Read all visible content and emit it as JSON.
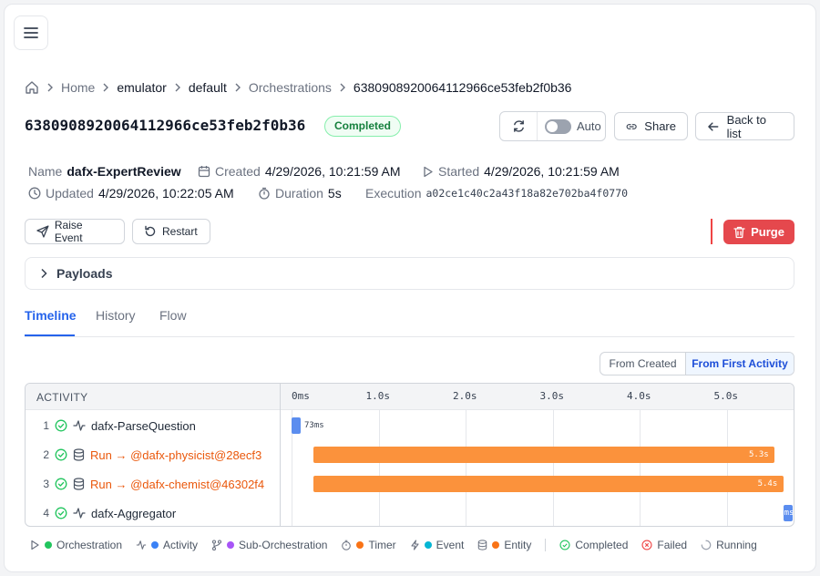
{
  "breadcrumb": {
    "items": [
      "Home",
      "emulator",
      "default",
      "Orchestrations",
      "6380908920064112966ce53feb2f0b36"
    ]
  },
  "title": "6380908920064112966ce53feb2f0b36",
  "status": "Completed",
  "toolbar": {
    "auto_label": "Auto",
    "share_label": "Share",
    "back_label": "Back to list"
  },
  "meta": {
    "name_label": "Name",
    "name_value": "dafx-ExpertReview",
    "created_label": "Created",
    "created_value": "4/29/2026, 10:21:59 AM",
    "started_label": "Started",
    "started_value": "4/29/2026, 10:21:59 AM",
    "updated_label": "Updated",
    "updated_value": "4/29/2026, 10:22:05 AM",
    "duration_label": "Duration",
    "duration_value": "5s",
    "execution_label": "Execution",
    "execution_value": "a02ce1c40c2a43f18a82e702ba4f0770"
  },
  "actions": {
    "raise_event": "Raise Event",
    "restart": "Restart",
    "purge": "Purge"
  },
  "payloads_label": "Payloads",
  "tabs": [
    "Timeline",
    "History",
    "Flow"
  ],
  "view_mode": {
    "options": [
      "From Created",
      "From First Activity"
    ],
    "selected": "From First Activity"
  },
  "timeline": {
    "header": "ACTIVITY",
    "ticks": [
      "0ms",
      "1.0s",
      "2.0s",
      "3.0s",
      "4.0s",
      "5.0s"
    ],
    "rows": [
      {
        "num": "1",
        "type": "activity",
        "label": "dafx-ParseQuestion",
        "start_s": 0.0,
        "duration_s": 0.073,
        "bar_label": "73ms",
        "color": "#5b8def"
      },
      {
        "num": "2",
        "type": "entity",
        "label": "Run → @dafx-physicist@28ecf3",
        "start_s": 0.25,
        "duration_s": 5.3,
        "bar_label": "5.3s",
        "color": "#fb923c"
      },
      {
        "num": "3",
        "type": "entity",
        "label": "Run → @dafx-chemist@46302f4",
        "start_s": 0.25,
        "duration_s": 5.4,
        "bar_label": "5.4s",
        "color": "#fb923c"
      },
      {
        "num": "4",
        "type": "activity",
        "label": "dafx-Aggregator",
        "start_s": 5.65,
        "duration_s": 0.1,
        "bar_label": "ms",
        "color": "#5b8def"
      }
    ]
  },
  "legend": {
    "types": [
      {
        "label": "Orchestration",
        "icon": "play-icon",
        "color": "#22c55e"
      },
      {
        "label": "Activity",
        "icon": "activity-icon",
        "color": "#3b82f6"
      },
      {
        "label": "Sub-Orchestration",
        "icon": "branch-icon",
        "color": "#a855f7"
      },
      {
        "label": "Timer",
        "icon": "timer-icon",
        "color": "#f97316"
      },
      {
        "label": "Event",
        "icon": "bolt-icon",
        "color": "#06b6d4"
      },
      {
        "label": "Entity",
        "icon": "database-icon",
        "color": "#f97316"
      }
    ],
    "statuses": [
      {
        "label": "Completed",
        "icon": "check-circle-icon",
        "color": "#22c55e"
      },
      {
        "label": "Failed",
        "icon": "x-circle-icon",
        "color": "#ef4444"
      },
      {
        "label": "Running",
        "icon": "spinner-icon",
        "color": "#9ca3af"
      }
    ]
  }
}
